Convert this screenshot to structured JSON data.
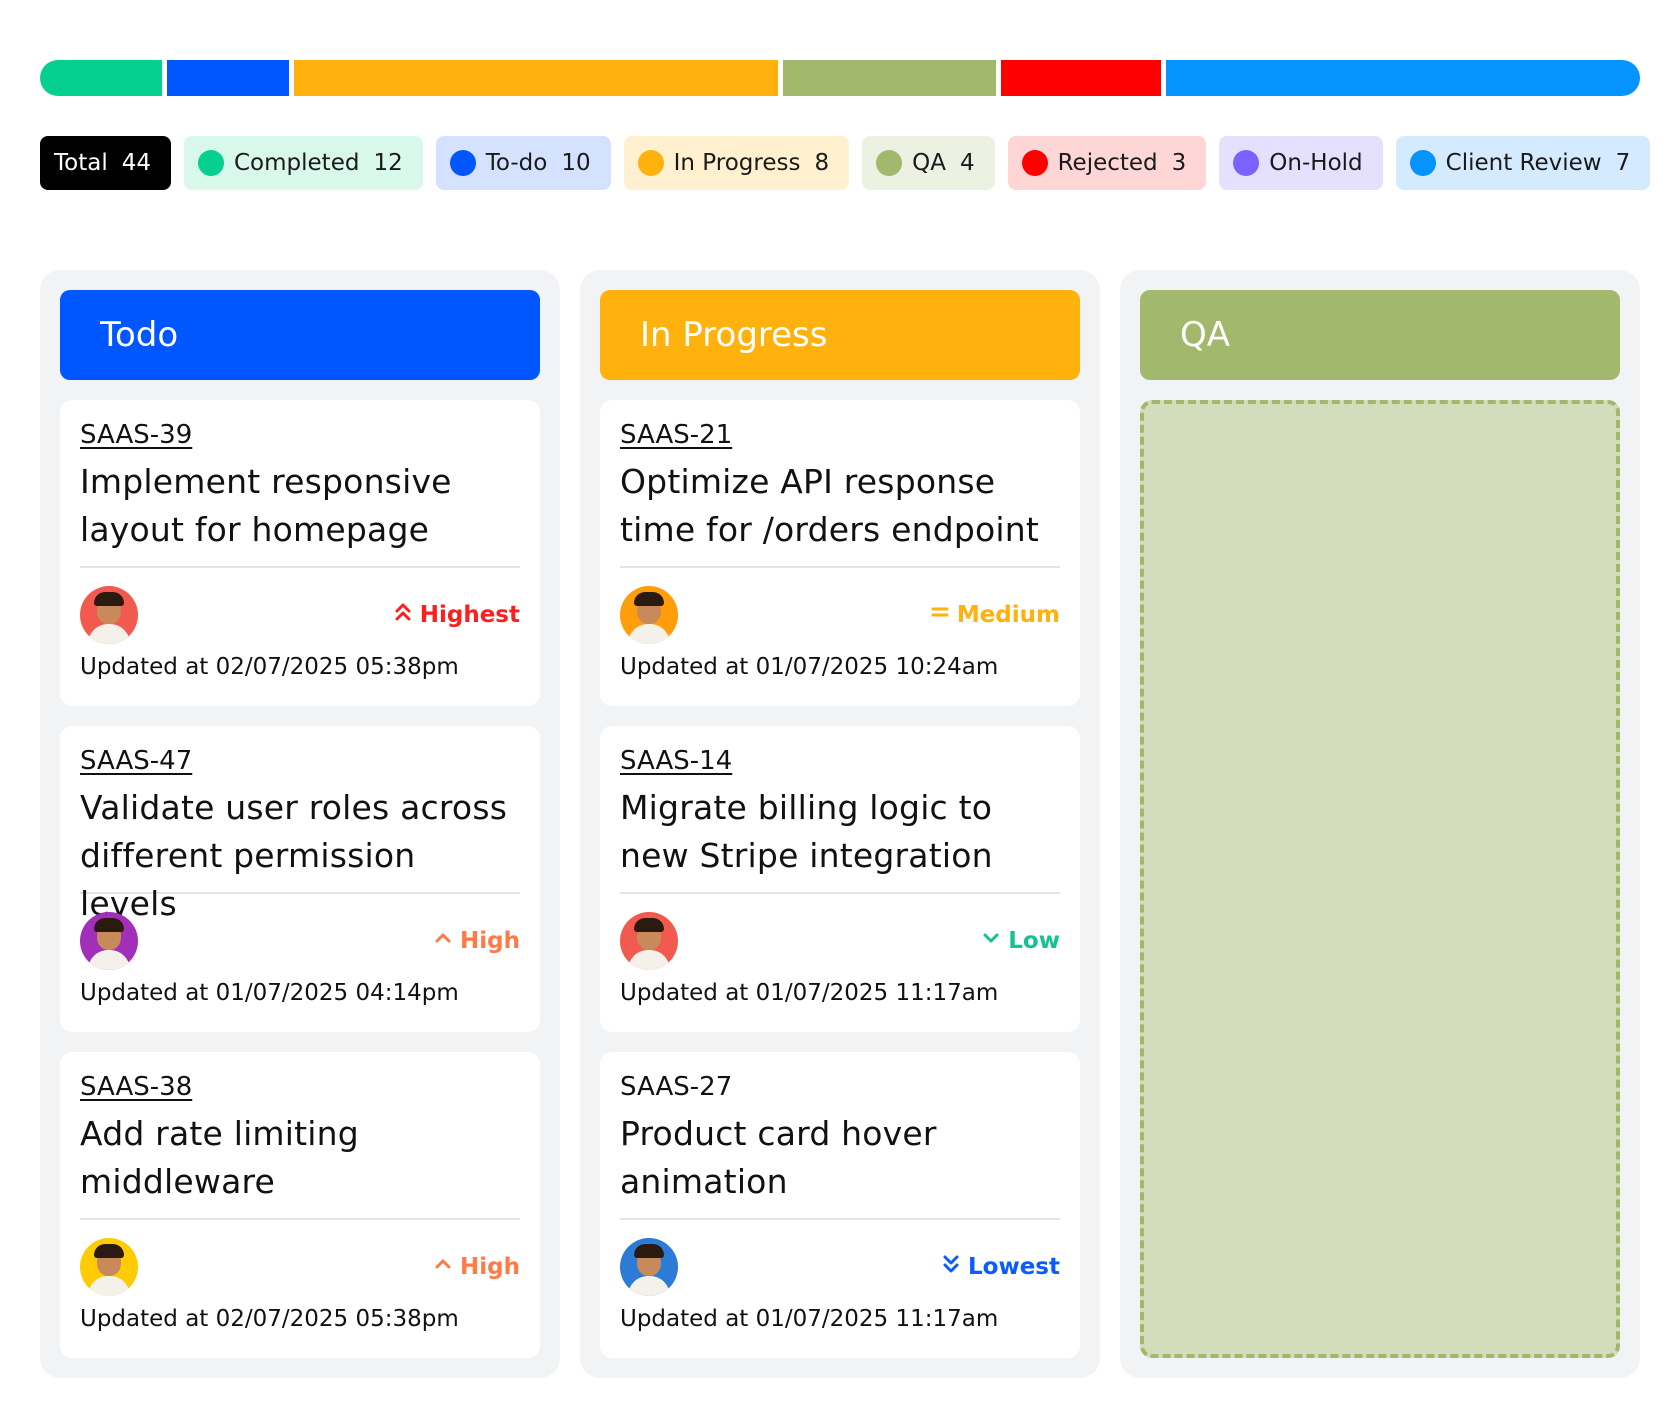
{
  "colors": {
    "completed": "#05d08f",
    "todo": "#0056ff",
    "in_progress": "#ffb10d",
    "qa": "#a2b86c",
    "rejected": "#ff0000",
    "on_hold": "#7b61ff",
    "client_review": "#0594ff"
  },
  "progress_segments": [
    {
      "name": "completed",
      "color": "#05d08f",
      "fraction": 0.0776
    },
    {
      "name": "todo",
      "color": "#0056ff",
      "fraction": 0.0776
    },
    {
      "name": "in_progress",
      "color": "#ffb10d",
      "fraction": 0.3071
    },
    {
      "name": "qa",
      "color": "#a2b86c",
      "fraction": 0.135
    },
    {
      "name": "rejected",
      "color": "#ff0000",
      "fraction": 0.1018
    },
    {
      "name": "client_review",
      "color": "#0594ff",
      "fraction": 0.301
    }
  ],
  "chips": {
    "total": {
      "label": "Total",
      "count": "44"
    },
    "completed": {
      "label": "Completed",
      "count": "12",
      "bg": "#d9f8ec",
      "dot": "#05d08f"
    },
    "todo": {
      "label": "To-do",
      "count": "10",
      "bg": "#d5e2ff",
      "dot": "#0056ff"
    },
    "in_progress": {
      "label": "In Progress",
      "count": "8",
      "bg": "#fff0cf",
      "dot": "#ffb10d"
    },
    "qa": {
      "label": "QA",
      "count": "4",
      "bg": "#ecf1e1",
      "dot": "#a2b86c"
    },
    "rejected": {
      "label": "Rejected",
      "count": "3",
      "bg": "#ffd6d6",
      "dot": "#ff0000"
    },
    "on_hold": {
      "label": "On-Hold",
      "count": "",
      "bg": "#e6e0ff",
      "dot": "#7b61ff"
    },
    "client_review": {
      "label": "Client Review",
      "count": "7",
      "bg": "#d4ebff",
      "dot": "#0594ff"
    }
  },
  "columns": {
    "todo": {
      "title": "Todo",
      "cards": [
        {
          "id": "SAAS-39",
          "title": "Implement responsive layout for homepage",
          "priority": "Highest",
          "priority_icon": "double-chevron-up-icon",
          "priority_color": "#ff1e1e",
          "updated": "Updated at 02/07/2025 05:38pm",
          "avatar_bg": "#f25a4f"
        },
        {
          "id": "SAAS-47",
          "title": "Validate user roles across different permission levels",
          "priority": "High",
          "priority_icon": "chevron-up-icon",
          "priority_color": "#ff7a45",
          "updated": "Updated at 01/07/2025 04:14pm",
          "avatar_bg": "#a12fb8"
        },
        {
          "id": "SAAS-38",
          "title": "Add rate limiting middleware",
          "priority": "High",
          "priority_icon": "chevron-up-icon",
          "priority_color": "#ff7a45",
          "updated": "Updated at 02/07/2025 05:38pm",
          "avatar_bg": "#ffcb05"
        }
      ]
    },
    "in_progress": {
      "title": "In Progress",
      "cards": [
        {
          "id": "SAAS-21",
          "title": "Optimize API response time for /orders endpoint",
          "priority": "Medium",
          "priority_icon": "equals-icon",
          "priority_color": "#ffb10d",
          "updated": "Updated at 01/07/2025 10:24am",
          "avatar_bg": "#ff9d0a"
        },
        {
          "id": "SAAS-14",
          "title": "Migrate billing logic to new Stripe integration",
          "priority": "Low",
          "priority_icon": "chevron-down-icon",
          "priority_color": "#12c491",
          "updated": "Updated at 01/07/2025 11:17am",
          "avatar_bg": "#f25a4f"
        },
        {
          "id": "SAAS-27",
          "title": "Product card hover animation",
          "priority": "Lowest",
          "priority_icon": "double-chevron-down-icon",
          "priority_color": "#0b5cff",
          "updated": "Updated at 01/07/2025 11:17am",
          "avatar_bg": "#2c7bd6"
        }
      ]
    },
    "qa": {
      "title": "QA",
      "cards": []
    }
  }
}
